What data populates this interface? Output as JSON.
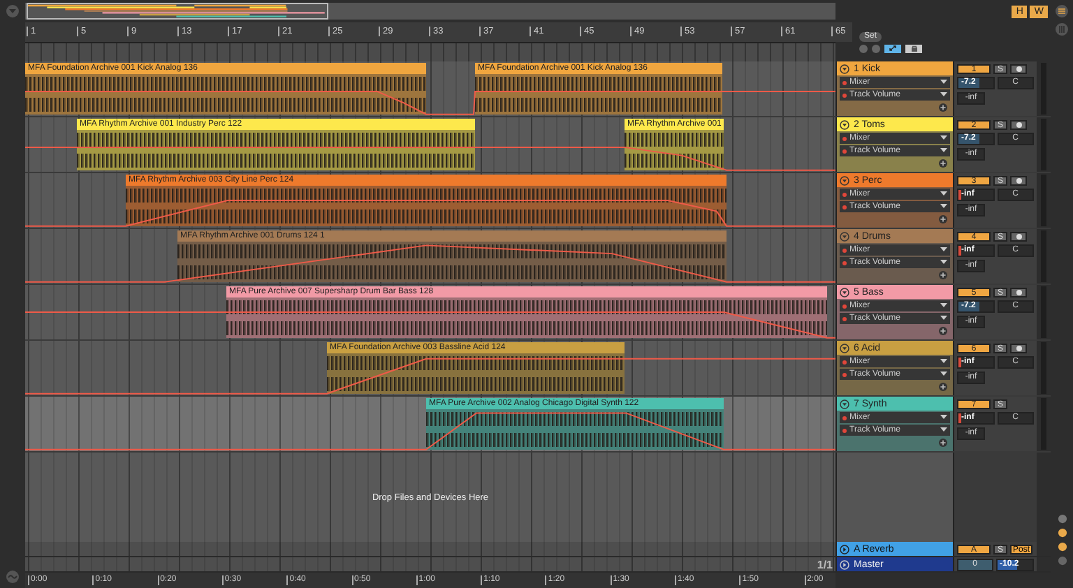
{
  "overview": {
    "buttons": [
      "H",
      "W"
    ]
  },
  "ruler": {
    "bars": [
      "1",
      "5",
      "9",
      "13",
      "17",
      "21",
      "25",
      "29",
      "33",
      "37",
      "41",
      "45",
      "49",
      "53",
      "57",
      "61",
      "65"
    ]
  },
  "set_button": "Set",
  "tracks": [
    {
      "name": "1 Kick",
      "color": "#f0a63f",
      "selected": false,
      "clips": [
        {
          "name": "MFA Foundation Archive 001 Kick Analog 136"
        },
        {
          "name": "MFA Foundation Archive 001 Kick Analog 136"
        }
      ],
      "device": "Mixer",
      "parameter": "Track Volume",
      "number": "1",
      "solo": "S",
      "arm": true,
      "volume": {
        "value": "-7.2",
        "level": 0.6
      },
      "pan": "C",
      "peak": "-inf"
    },
    {
      "name": "2 Toms",
      "color": "#fde84c",
      "selected": false,
      "clips": [
        {
          "name": "MFA Rhythm Archive 001 Industry Perc 122"
        },
        {
          "name": "MFA Rhythm Archive 001"
        }
      ],
      "device": "Mixer",
      "parameter": "Track Volume",
      "number": "2",
      "solo": "S",
      "arm": true,
      "volume": {
        "value": "-7.2",
        "level": 0.6
      },
      "pan": "C",
      "peak": "-inf"
    },
    {
      "name": "3 Perc",
      "color": "#ee7a2c",
      "selected": false,
      "clips": [
        {
          "name": "MFA Rhythm Archive 003 City Line Perc 124"
        }
      ],
      "device": "Mixer",
      "parameter": "Track Volume",
      "number": "3",
      "solo": "S",
      "arm": true,
      "volume": {
        "value": "-inf",
        "level": 0
      },
      "pan": "C",
      "peak": "-inf"
    },
    {
      "name": "4 Drums",
      "color": "#a47a54",
      "selected": false,
      "clips": [
        {
          "name": "MFA Rhythm Archive 001 Drums 124 1"
        }
      ],
      "device": "Mixer",
      "parameter": "Track Volume",
      "number": "4",
      "solo": "S",
      "arm": true,
      "volume": {
        "value": "-inf",
        "level": 0
      },
      "pan": "C",
      "peak": "-inf"
    },
    {
      "name": "5 Bass",
      "color": "#f29aa6",
      "selected": false,
      "clips": [
        {
          "name": "MFA Pure Archive 007 Supersharp Drum Bar Bass 128"
        }
      ],
      "device": "Mixer",
      "parameter": "Track Volume",
      "number": "5",
      "solo": "S",
      "arm": true,
      "volume": {
        "value": "-7.2",
        "level": 0.6
      },
      "pan": "C",
      "peak": "-inf"
    },
    {
      "name": "6 Acid",
      "color": "#c89f42",
      "selected": false,
      "clips": [
        {
          "name": "MFA Foundation Archive 003 Bassline Acid 124"
        }
      ],
      "device": "Mixer",
      "parameter": "Track Volume",
      "number": "6",
      "solo": "S",
      "arm": true,
      "volume": {
        "value": "-inf",
        "level": 0
      },
      "pan": "C",
      "peak": "-inf"
    },
    {
      "name": "7 Synth",
      "color": "#4dbfae",
      "selected": true,
      "clips": [
        {
          "name": "MFA Pure Archive 002 Analog Chicago Digital Synth 122"
        }
      ],
      "device": "Mixer",
      "parameter": "Track Volume",
      "number": "7",
      "solo": "S",
      "arm": false,
      "volume": {
        "value": "-inf",
        "level": 0
      },
      "pan": "C",
      "peak": "-inf"
    }
  ],
  "drop_hint": "Drop Files and Devices Here",
  "returns": [
    {
      "name": "A Reverb",
      "color": "#41a1e6",
      "number": "A",
      "solo": "S",
      "send_mode": "Post"
    }
  ],
  "master": {
    "name": "Master",
    "color": "#1f3a8e",
    "cue": "0",
    "volume": {
      "value": "-10.2",
      "level": 0.55
    }
  },
  "page_indicator": "1/1",
  "time_ruler": {
    "labels": [
      "0:00",
      "0:10",
      "0:20",
      "0:30",
      "0:40",
      "0:50",
      "1:00",
      "1:10",
      "1:20",
      "1:30",
      "1:40",
      "1:50",
      "2:00"
    ]
  }
}
